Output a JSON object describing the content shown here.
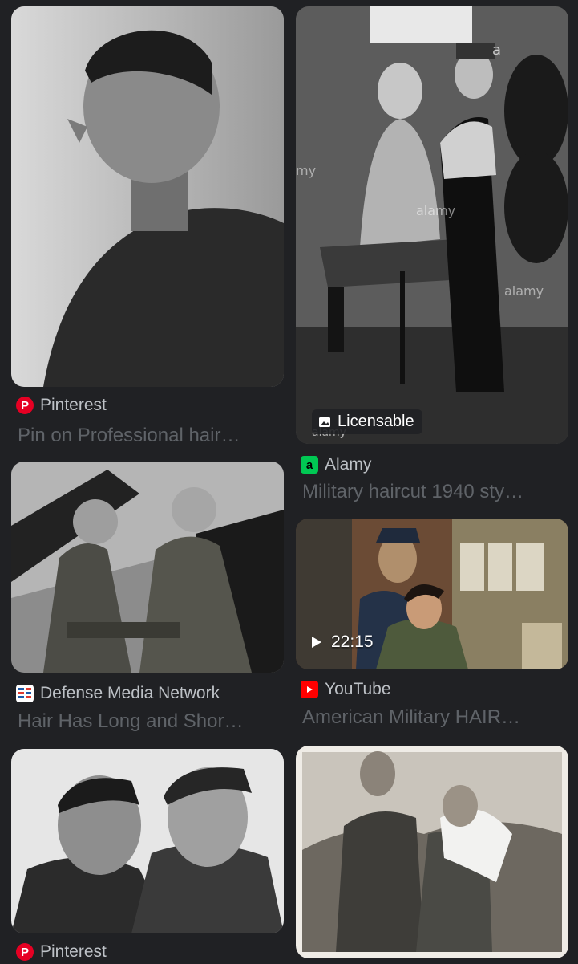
{
  "results": {
    "left": [
      {
        "source": "Pinterest",
        "title": "Pin on Professional hair…",
        "favicon": "pinterest-icon"
      },
      {
        "source": "Defense Media Network",
        "title": "Hair Has Long and Shor…",
        "favicon": "defense-media-network-icon"
      },
      {
        "source": "Pinterest",
        "title": "",
        "favicon": "pinterest-icon"
      }
    ],
    "right": [
      {
        "source": "Alamy",
        "title": "Military haircut 1940 sty…",
        "favicon": "alamy-icon",
        "badge": "Licensable"
      },
      {
        "source": "YouTube",
        "title": "American Military HAIR…",
        "favicon": "youtube-icon",
        "duration": "22:15"
      },
      {
        "source": "",
        "title": "",
        "favicon": ""
      }
    ]
  },
  "watermark": "alamy",
  "colors": {
    "background": "#202124",
    "source_text": "#bdc1c6",
    "title_text": "#5f6368",
    "pinterest": "#e60023",
    "alamy": "#00c853",
    "youtube": "#ff0000"
  }
}
